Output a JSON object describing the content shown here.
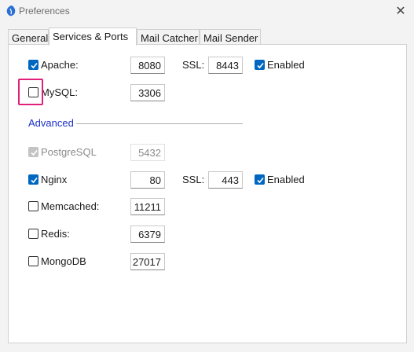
{
  "window": {
    "title": "Preferences",
    "close_glyph": "✕",
    "icon": "app-icon"
  },
  "tabs": [
    {
      "label": "General",
      "active": false
    },
    {
      "label": "Services & Ports",
      "active": true
    },
    {
      "label": "Mail Catcher",
      "active": false
    },
    {
      "label": "Mail Sender",
      "active": false
    }
  ],
  "services": {
    "apache": {
      "label": "Apache:",
      "checked": true,
      "port": "8080",
      "ssl_label": "SSL:",
      "ssl_port": "8443",
      "enabled_label": "Enabled",
      "enabled": true
    },
    "mysql": {
      "label": "MySQL:",
      "checked": false,
      "port": "3306"
    },
    "advanced_label": "Advanced",
    "postgresql": {
      "label": "PostgreSQL",
      "checked": true,
      "disabled": true,
      "port": "5432"
    },
    "nginx": {
      "label": "Nginx",
      "checked": true,
      "port": "80",
      "ssl_label": "SSL:",
      "ssl_port": "443",
      "enabled_label": "Enabled",
      "enabled": true
    },
    "memcached": {
      "label": "Memcached:",
      "checked": false,
      "port": "11211"
    },
    "redis": {
      "label": "Redis:",
      "checked": false,
      "port": "6379"
    },
    "mongodb": {
      "label": "MongoDB",
      "checked": false,
      "port": "27017"
    }
  },
  "colors": {
    "accent": "#0067c0",
    "section_link": "#1a30c8",
    "highlight": "#e0207a"
  }
}
